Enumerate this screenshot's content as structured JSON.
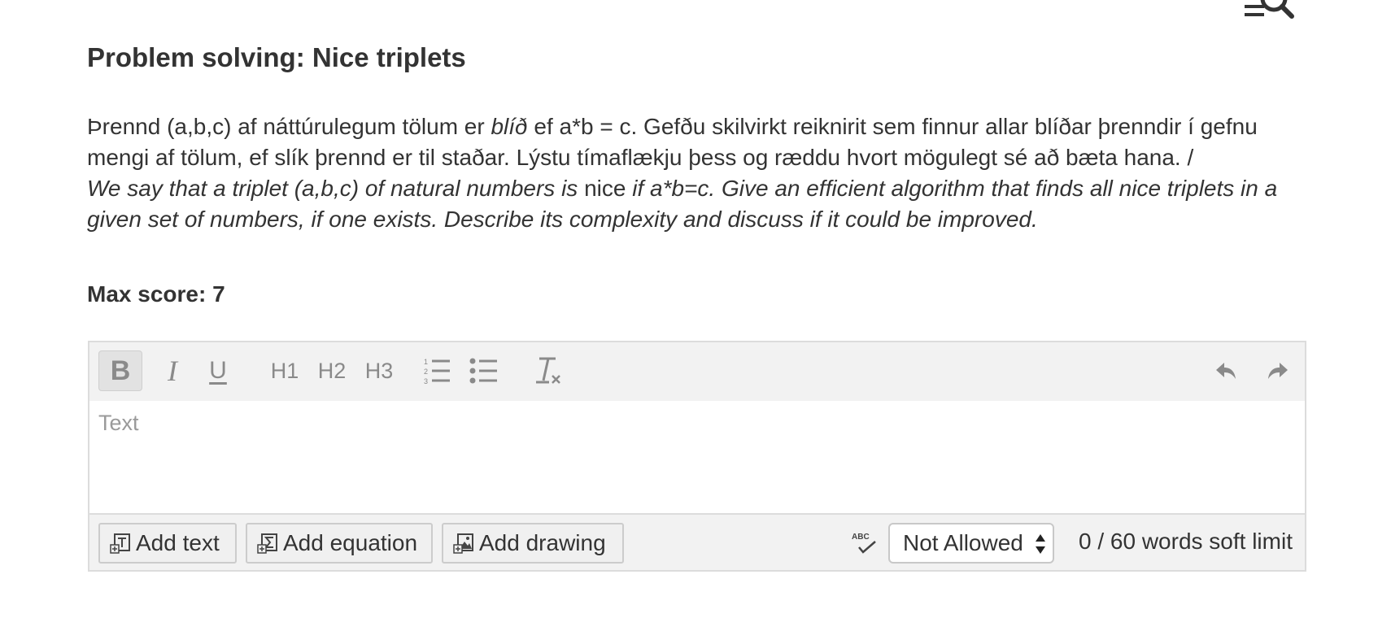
{
  "question": {
    "title": "Problem solving: Nice triplets",
    "icelandic_line1_a": "Þrennd (a,b,c) af náttúrulegum tölum er ",
    "icelandic_line1_term": "blíð",
    "icelandic_line1_b": " ef a*b = c. Gefðu skilvirkt reiknirit sem finnur allar blíðar þrenndir í gefnu",
    "icelandic_line2": "mengi af tölum, ef slík þrennd er til staðar. Lýstu tímaflækju þess og ræddu hvort mögulegt sé að bæta hana. /",
    "english_line1_a": "We say that a triplet (a,b,c) of natural numbers is ",
    "english_line1_term": "nice",
    "english_line1_b": " if a*b=c. Give an efficient algorithm that finds all nice triplets in a",
    "english_line2": "given set of numbers, if one exists. Describe its complexity and discuss if it could be improved.",
    "max_score": "Max score: 7"
  },
  "toolbar": {
    "bold": "B",
    "italic": "I",
    "underline": "U",
    "h1": "H1",
    "h2": "H2",
    "h3": "H3",
    "icons": [
      "bold-icon",
      "italic-icon",
      "underline-icon",
      "ordered-list-icon",
      "bullet-list-icon",
      "clear-format-icon",
      "undo-icon",
      "redo-icon"
    ]
  },
  "editor": {
    "placeholder": "Text"
  },
  "footer": {
    "add_text": "Add text",
    "add_equation": "Add equation",
    "add_drawing": "Add drawing",
    "spellcheck_label": "ABC",
    "spellcheck_value": "Not Allowed",
    "word_count": "0 / 60 words soft limit"
  },
  "colors": {
    "text": "#333333",
    "toolbar_bg": "#f2f2f2",
    "border": "#dcdcdc",
    "icon": "#8a8a8a"
  }
}
